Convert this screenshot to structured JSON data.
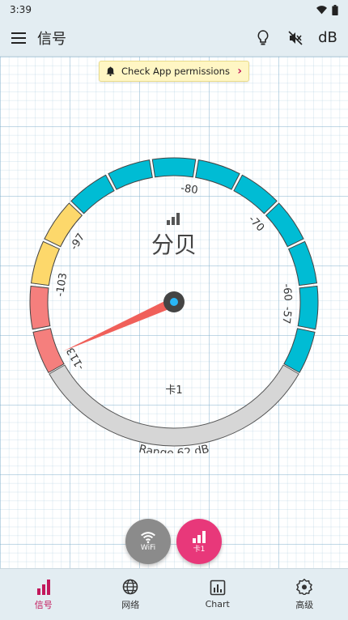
{
  "status_bar": {
    "time": "3:39"
  },
  "app_bar": {
    "title": "信号",
    "db_label": "dB"
  },
  "banner": {
    "text": "Check App permissions"
  },
  "gauge": {
    "unit_label": "分贝",
    "sim_label": "卡1",
    "range_label": "Range 62 dB",
    "scale_labels": [
      "-113",
      "-103",
      "-97",
      "-80",
      "-70",
      "-60",
      "-57"
    ],
    "min_dbm": -113,
    "max_dbm": -51,
    "needle_dbm": -113,
    "colors": {
      "teal": "#00bcd4",
      "yellow": "#fdd86b",
      "red": "#f57f7d",
      "gray": "#d6d6d6",
      "needle": "#f0605a",
      "hub": "#444444",
      "hub_dot": "#29b6f6"
    }
  },
  "fab": {
    "wifi_label": "WiFi",
    "sim_label": "卡1"
  },
  "bottom_nav": {
    "items": [
      {
        "label": "信号",
        "icon": "signal-bars-icon",
        "active": true
      },
      {
        "label": "网络",
        "icon": "globe-icon",
        "active": false
      },
      {
        "label": "Chart",
        "icon": "chart-icon",
        "active": false
      },
      {
        "label": "高级",
        "icon": "settings-badge-icon",
        "active": false
      }
    ]
  }
}
